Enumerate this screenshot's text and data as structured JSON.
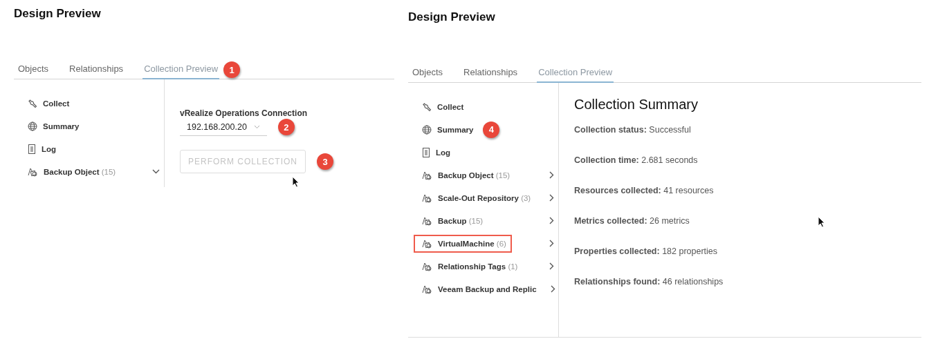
{
  "panels": [
    {
      "title": "Design Preview",
      "tabs": [
        {
          "label": "Objects",
          "selected": false
        },
        {
          "label": "Relationships",
          "selected": false
        },
        {
          "label": "Collection Preview",
          "selected": true,
          "callout": "1"
        }
      ],
      "nav": [
        {
          "kind": "wrench",
          "label": "Collect",
          "highlighted": false
        },
        {
          "kind": "globe",
          "label": "Summary",
          "highlighted": false
        },
        {
          "kind": "document",
          "label": "Log",
          "highlighted": false
        },
        {
          "kind": "objects",
          "label": "Backup Object",
          "count": "(15)",
          "expanded": true,
          "highlighted": false
        }
      ],
      "content": {
        "kind": "collect",
        "connection_label": "vRealize Operations Connection",
        "connection_value": "192.168.200.20",
        "connection_callout": "2",
        "button": {
          "label": "PERFORM COLLECTION",
          "disabled": true,
          "callout": "3"
        }
      }
    },
    {
      "title": "Design Preview",
      "tabs": [
        {
          "label": "Objects",
          "selected": false
        },
        {
          "label": "Relationships",
          "selected": false
        },
        {
          "label": "Collection Preview",
          "selected": true
        }
      ],
      "nav": [
        {
          "kind": "wrench",
          "label": "Collect",
          "highlighted": false
        },
        {
          "kind": "globe",
          "label": "Summary",
          "highlighted": false,
          "callout": "4"
        },
        {
          "kind": "document",
          "label": "Log",
          "highlighted": false
        },
        {
          "kind": "objects",
          "label": "Backup Object",
          "count": "(15)",
          "expanded": false,
          "highlighted": false
        },
        {
          "kind": "objects",
          "label": "Scale-Out Repository",
          "count": "(3)",
          "expanded": false,
          "highlighted": false
        },
        {
          "kind": "objects",
          "label": "Backup",
          "count": "(15)",
          "expanded": false,
          "highlighted": false
        },
        {
          "kind": "objects",
          "label": "VirtualMachine",
          "count": "(6)",
          "expanded": false,
          "highlighted": true
        },
        {
          "kind": "objects",
          "label": "Relationship Tags",
          "count": "(1)",
          "expanded": false,
          "highlighted": false
        },
        {
          "kind": "objects",
          "label": "Veeam Backup and Replic",
          "expanded": false,
          "highlighted": false
        }
      ],
      "content": {
        "kind": "summary",
        "heading": "Collection Summary",
        "lines": [
          "**Collection status:** Successful",
          "**Collection time:** 2.681 seconds",
          "**Resources collected:** 41 resources",
          "**Metrics collected:** 26 metrics",
          "**Properties collected:** 182 properties",
          "**Relationships found:** 46 relationships"
        ]
      }
    }
  ]
}
